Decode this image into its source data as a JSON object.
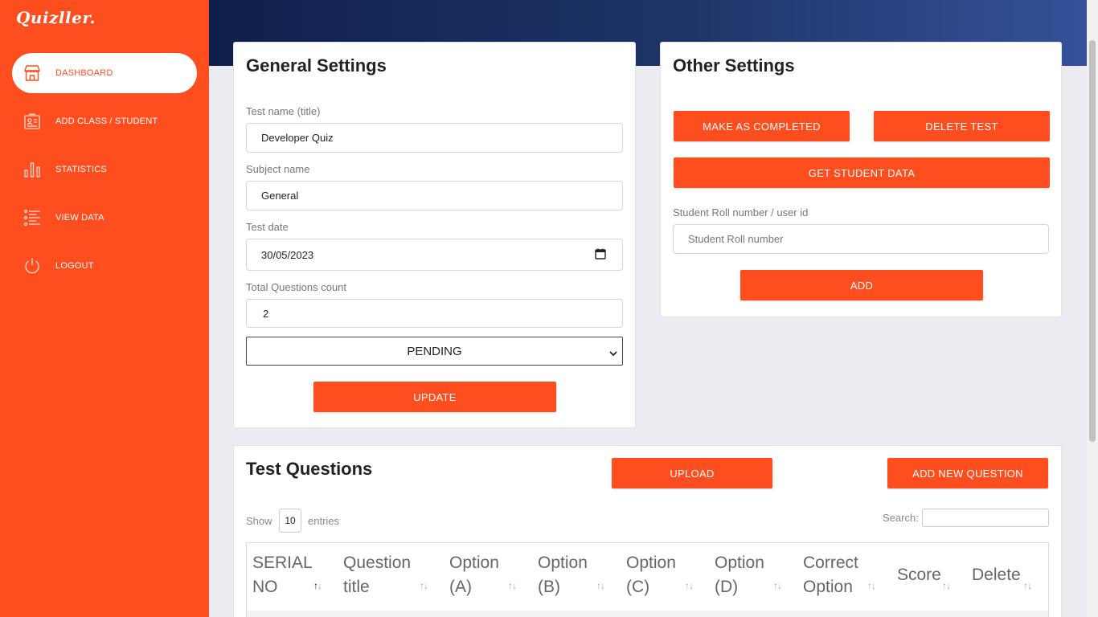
{
  "app": {
    "logo": "Quizller."
  },
  "sidebar": {
    "items": [
      {
        "label": "DASHBOARD",
        "icon": "store-icon"
      },
      {
        "label": "ADD CLASS / STUDENT",
        "icon": "id-card-icon"
      },
      {
        "label": "STATISTICS",
        "icon": "bar-chart-icon"
      },
      {
        "label": "VIEW DATA",
        "icon": "list-icon"
      },
      {
        "label": "LOGOUT",
        "icon": "power-icon"
      }
    ]
  },
  "general": {
    "title": "General Settings",
    "test_name_label": "Test name (title)",
    "test_name_value": "Developer Quiz",
    "subject_label": "Subject name",
    "subject_value": "General",
    "date_label": "Test date",
    "date_value": "30/05/2023",
    "count_label": "Total Questions count",
    "count_value": "2",
    "status_value": "PENDING",
    "update_label": "UPDATE"
  },
  "other": {
    "title": "Other Settings",
    "complete_label": "MAKE AS COMPLETED",
    "delete_label": "DELETE TEST",
    "student_data_label": "GET STUDENT DATA",
    "roll_label": "Student Roll number / user id",
    "roll_placeholder": "Student Roll number",
    "add_label": "ADD"
  },
  "questions": {
    "title": "Test Questions",
    "upload_label": "UPLOAD",
    "add_new_label": "ADD NEW QUESTION",
    "show_label": "Show",
    "entries_value": "10",
    "entries_label": "entries",
    "search_label": "Search:",
    "columns": [
      {
        "line1": "SERIAL",
        "line2": "NO"
      },
      {
        "line1": "Question",
        "line2": "title"
      },
      {
        "line1": "Option",
        "line2": "(A)"
      },
      {
        "line1": "Option",
        "line2": "(B)"
      },
      {
        "line1": "Option",
        "line2": "(C)"
      },
      {
        "line1": "Option",
        "line2": "(D)"
      },
      {
        "line1": "Correct",
        "line2": "Option"
      },
      {
        "line1": "Score",
        "line2": ""
      },
      {
        "line1": "Delete",
        "line2": ""
      }
    ]
  },
  "colors": {
    "accent": "#fe4e1f",
    "header_dark": "#0f1f4b",
    "header_light": "#34529a"
  }
}
